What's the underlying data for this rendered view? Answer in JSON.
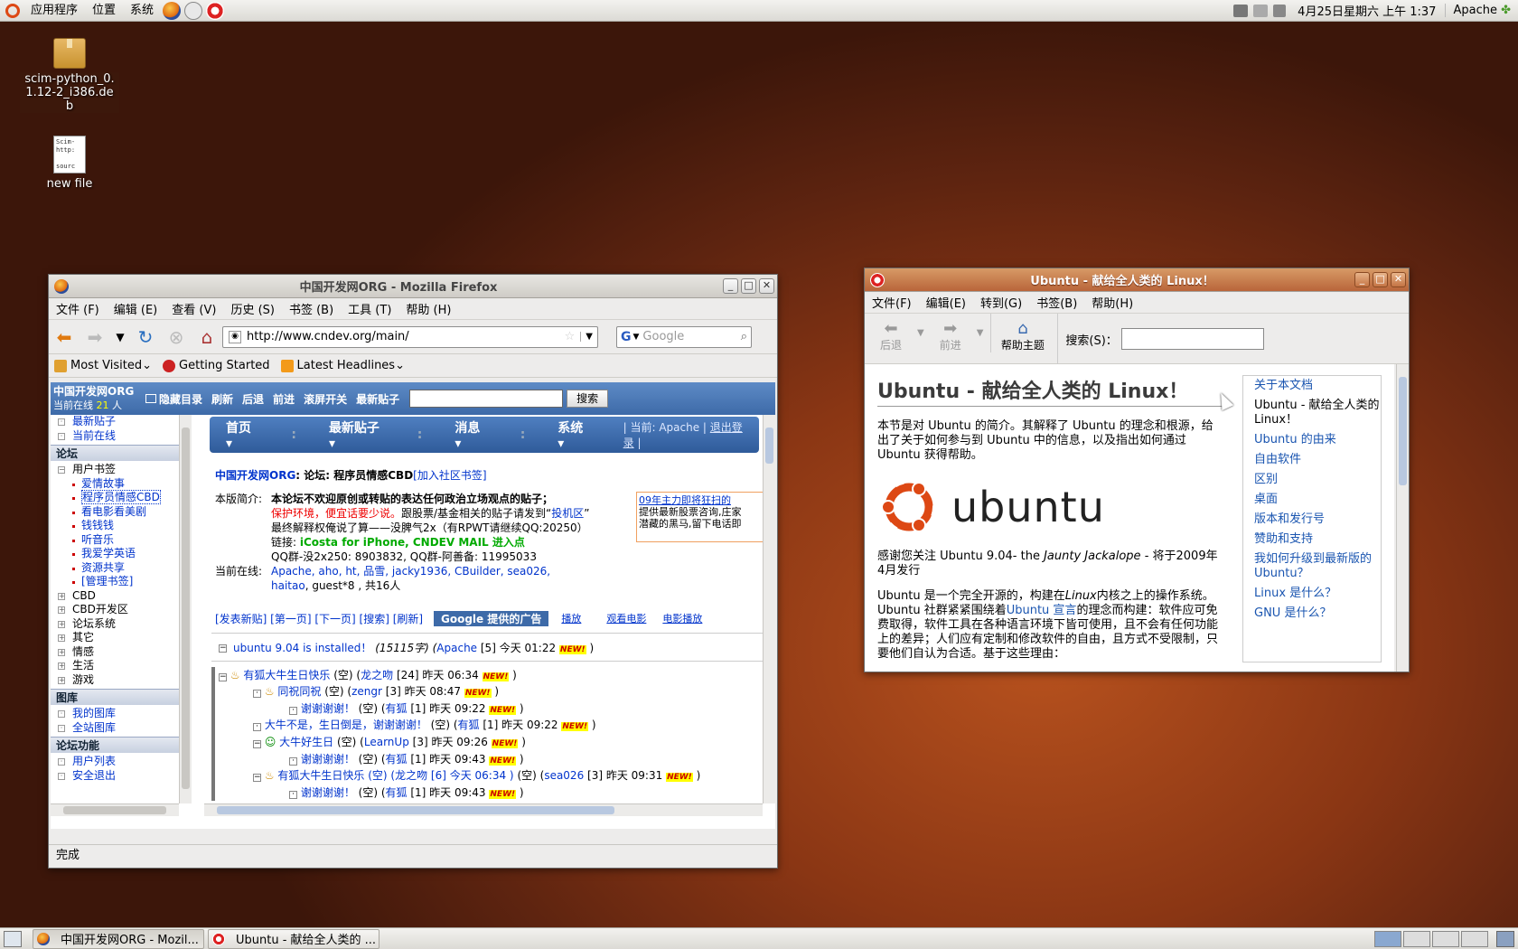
{
  "top_panel": {
    "applications": "应用程序",
    "places": "位置",
    "system": "系统",
    "clock": "4月25日星期六 上午 1:37",
    "user": "Apache"
  },
  "desktop": {
    "icons": [
      {
        "label": "scim-python_0.1.12-2_i386.deb"
      },
      {
        "label": "new file",
        "preview": "Scim-\nhttp:\n\nsourc"
      }
    ]
  },
  "firefox": {
    "title": "中国开发网ORG - Mozilla Firefox",
    "menu": [
      "文件 (F)",
      "编辑 (E)",
      "查看 (V)",
      "历史 (S)",
      "书签 (B)",
      "工具 (T)",
      "帮助 (H)"
    ],
    "url": "http://www.cndev.org/main/",
    "search_placeholder": "Google",
    "bookmarks": [
      "Most Visited",
      "Getting Started",
      "Latest Headlines"
    ],
    "forum": {
      "site_name": "中国开发网ORG",
      "online_prefix": "当前在线",
      "online_count": "21",
      "online_suffix": "人",
      "toolbar": [
        "隐藏目录",
        "刷新",
        "后退",
        "前进",
        "滚屏开关",
        "最新贴子"
      ],
      "search_button": "搜索",
      "left_nav": {
        "top": [
          "最新贴子",
          "当前在线"
        ],
        "sec_forum": "论坛",
        "user_bookmarks": "用户书签",
        "bookmarks": [
          "爱情故事",
          "程序员情感CBD",
          "看电影看美剧",
          "钱钱钱",
          "听音乐",
          "我爱学英语",
          "资源共享",
          "[管理书签]"
        ],
        "forums": [
          "CBD",
          "CBD开发区",
          "论坛系统",
          "其它",
          "情感",
          "生活",
          "游戏"
        ],
        "sec_gallery": "图库",
        "gallery": [
          "我的图库",
          "全站图库"
        ],
        "sec_functions": "论坛功能",
        "functions": [
          "用户列表",
          "安全退出"
        ]
      },
      "tabs": [
        "首页",
        "最新贴子",
        "消息",
        "系统"
      ],
      "current_user": "| 当前: Apache |",
      "logout": "退出登录",
      "sep": "|",
      "breadcrumb": {
        "site": "中国开发网ORG",
        "sep": ": 论坛: 程序员情感CBD",
        "join": "[加入社区书签]"
      },
      "intro_label": "本版简介:",
      "intro_bold": "本论坛不欢迎原创或转贴的表达任何政治立场观点的贴子；",
      "intro_red": "保护环境，便宜话要少说。",
      "intro_rest": "跟股票/基金相关的贴子请发到“",
      "intro_link": "投机区",
      "intro_end": "”",
      "intro_line3": "最终解释权俺说了算——没脾气2x（有RPWT请继续QQ:20250）",
      "intro_link_label": "链接:",
      "intro_links": "iCosta for iPhone, CNDEV MAIL 进入点",
      "intro_qq": "QQ群-没2x250: 8903832, QQ群-阿善备: 11995033",
      "online_label": "当前在线:",
      "online_users": "Apache, aho, ht, 品雪, jacky1936, CBuilder, sea026,",
      "online_users2": "haitao",
      "online_tail": ", guest*8 , 共16人",
      "ad_title": "09年主力即将狂扫的",
      "ad_line1": "提供最新股票咨询,庄家",
      "ad_line2": "潜藏的黑马,留下电话即",
      "actions": "[发表新贴] [第一页] [下一页] [搜索] [刷新]",
      "google_ads": "Google 提供的广告",
      "ad_links": [
        "播放",
        "观看电影",
        "电影播放"
      ],
      "threads": [
        {
          "t": "ubuntu 9.04 is installed！",
          "m": "(15115字) (",
          "a": "Apache",
          "d": " [5] 今天 01:22 ",
          "e": " )"
        },
        {
          "t": "有狐大牛生日快乐",
          "m": " (空) (",
          "a": "龙之吻",
          "d": " [24] 昨天 06:34 ",
          "e": " )"
        },
        {
          "t": "同祝同祝",
          "m": " (空) (",
          "a": "zengr",
          "d": " [3] 昨天 08:47 ",
          "e": " )"
        },
        {
          "t": "谢谢谢谢！",
          "m": " (空) (",
          "a": "有狐",
          "d": " [1] 昨天 09:22 ",
          "e": " )"
        },
        {
          "t": "大牛不是，生日倒是，谢谢谢谢！",
          "m": " (空) (",
          "a": "有狐",
          "d": " [1] 昨天 09:22 ",
          "e": " )"
        },
        {
          "t": "大牛好生日",
          "m": " (空) (",
          "a": "LearnUp",
          "d": " [3] 昨天 09:26 ",
          "e": " )"
        },
        {
          "t": "谢谢谢谢！",
          "m": " (空) (",
          "a": "有狐",
          "d": " [1] 昨天 09:43 ",
          "e": " )"
        },
        {
          "t": "有狐大牛生日快乐 (空) (龙之吻 [6] 今天 06:34 )",
          "m": " (空) (",
          "a": "sea026",
          "d": " [3] 昨天 09:31 ",
          "e": " )"
        },
        {
          "t": "谢谢谢谢！",
          "m": " (空) (",
          "a": "有狐",
          "d": " [1] 昨天 09:43 ",
          "e": " )"
        }
      ],
      "new_badge": "NEW!"
    },
    "status": "完成"
  },
  "yelp": {
    "title": "Ubuntu - 献给全人类的 Linux！",
    "menu": [
      "文件(F)",
      "编辑(E)",
      "转到(G)",
      "书签(B)",
      "帮助(H)"
    ],
    "back": "后退",
    "forward": "前进",
    "help_topics": "帮助主题",
    "search_label": "搜索(S)：",
    "heading": "Ubuntu - 献给全人类的 Linux！",
    "p1": "本节是对 Ubuntu 的简介。其解释了 Ubuntu 的理念和根源，给出了关于如何参与到 Ubuntu 中的信息，以及指出如何通过 Ubuntu 获得帮助。",
    "logo_text": "ubuntu",
    "p2a": "感谢您关注 Ubuntu 9.04- the ",
    "p2i": "Jaunty Jackalope",
    "p2b": " - 将于2009年4月发行",
    "p3a": "Ubuntu 是一个完全开源的，构建在",
    "p3i": "Linux",
    "p3b": "内核之上的操作系统。Ubuntu 社群紧紧围绕着",
    "p3l": "Ubuntu 宣言",
    "p3c": "的理念而构建：软件应可免费取得，软件工具在各种语言环境下皆可使用，且不会有任何功能上的差异；人们应有定制和修改软件的自由，且方式不受限制，只要他们自认为合适。基于这些理由：",
    "toc": [
      "关于本文档",
      "Ubuntu - 献给全人类的 Linux！",
      "Ubuntu 的由来",
      "自由软件",
      "区别",
      "桌面",
      "版本和发行号",
      "赞助和支持",
      "我如何升级到最新版的 Ubuntu？",
      "Linux 是什么？",
      "GNU 是什么？"
    ]
  },
  "taskbar": {
    "tasks": [
      "中国开发网ORG - Mozil...",
      "Ubuntu - 献给全人类的 ..."
    ]
  },
  "colors": {
    "ubuntu_orange": "#dd4814",
    "forum_blue": "#3d6aa8",
    "link_blue": "#0033cc"
  }
}
